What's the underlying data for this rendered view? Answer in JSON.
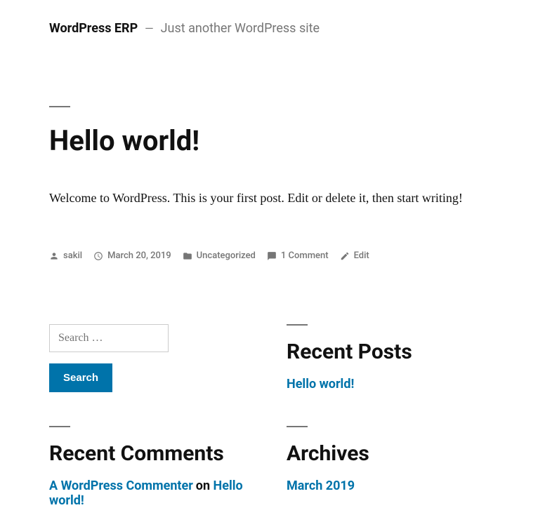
{
  "site": {
    "title": "WordPress ERP",
    "tagline": "Just another WordPress site"
  },
  "post": {
    "title": "Hello world!",
    "content": "Welcome to WordPress. This is your first post. Edit or delete it, then start writing!",
    "author": "sakil",
    "date": "March 20, 2019",
    "category": "Uncategorized",
    "comments": "1 Comment",
    "edit": "Edit"
  },
  "widgets": {
    "search": {
      "placeholder": "Search …",
      "button": "Search"
    },
    "recentPosts": {
      "title": "Recent Posts",
      "items": [
        "Hello world!"
      ]
    },
    "recentComments": {
      "title": "Recent Comments",
      "items": [
        {
          "author": "A WordPress Commenter",
          "on": "on",
          "post": "Hello world!"
        }
      ]
    },
    "archives": {
      "title": "Archives",
      "items": [
        "March 2019"
      ]
    }
  }
}
